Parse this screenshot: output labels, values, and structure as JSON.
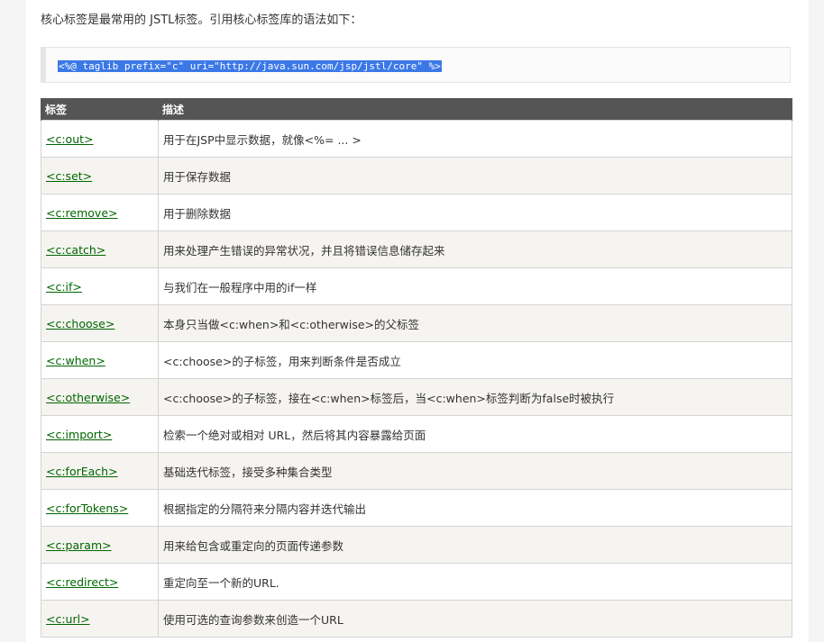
{
  "intro": "核心标签是最常用的 JSTL标签。引用核心标签库的语法如下：",
  "code": "<%@ taglib prefix=\"c\" uri=\"http://java.sun.com/jsp/jstl/core\" %>",
  "table": {
    "headers": [
      "标签",
      "描述"
    ],
    "rows": [
      {
        "tag": "<c:out>",
        "desc": "用于在JSP中显示数据，就像<%= ... >"
      },
      {
        "tag": "<c:set>",
        "desc": "用于保存数据"
      },
      {
        "tag": "<c:remove>",
        "desc": "用于删除数据"
      },
      {
        "tag": "<c:catch>",
        "desc": "用来处理产生错误的异常状况，并且将错误信息储存起来"
      },
      {
        "tag": "<c:if>",
        "desc": "与我们在一般程序中用的if一样"
      },
      {
        "tag": "<c:choose>",
        "desc": "本身只当做<c:when>和<c:otherwise>的父标签"
      },
      {
        "tag": "<c:when>",
        "desc": "<c:choose>的子标签，用来判断条件是否成立"
      },
      {
        "tag": "<c:otherwise>",
        "desc": "<c:choose>的子标签，接在<c:when>标签后，当<c:when>标签判断为false时被执行"
      },
      {
        "tag": "<c:import>",
        "desc": "检索一个绝对或相对 URL，然后将其内容暴露给页面"
      },
      {
        "tag": "<c:forEach>",
        "desc": "基础迭代标签，接受多种集合类型"
      },
      {
        "tag": "<c:forTokens>",
        "desc": "根据指定的分隔符来分隔内容并迭代输出"
      },
      {
        "tag": "<c:param>",
        "desc": "用来给包含或重定向的页面传递参数"
      },
      {
        "tag": "<c:redirect>",
        "desc": "重定向至一个新的URL."
      },
      {
        "tag": "<c:url>",
        "desc": "使用可选的查询参数来创造一个URL"
      }
    ]
  },
  "colors": {
    "header_bg": "#555555",
    "link": "#006600",
    "selection": "#3b78e7",
    "row_alt": "#f6f4f0"
  }
}
